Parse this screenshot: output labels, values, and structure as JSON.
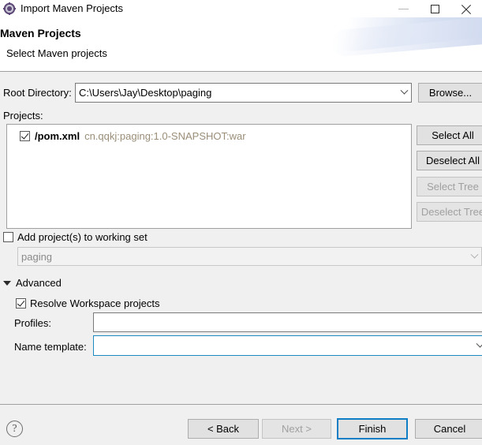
{
  "window": {
    "title": "Import Maven Projects",
    "icon": "maven-gear-icon",
    "controls": {
      "minimize": "minimize-icon",
      "maximize": "maximize-icon",
      "close": "close-icon"
    }
  },
  "header": {
    "title": "Maven Projects",
    "subtitle": "Select Maven projects"
  },
  "root_directory": {
    "label": "Root Directory:",
    "value": "C:\\Users\\Jay\\Desktop\\paging",
    "placeholder": "",
    "browse_label": "Browse..."
  },
  "projects": {
    "label": "Projects:",
    "items": [
      {
        "checked": true,
        "name": "/pom.xml",
        "coordinates": "cn.qqkj:paging:1.0-SNAPSHOT:war"
      }
    ],
    "buttons": {
      "select_all": "Select All",
      "deselect_all": "Deselect All",
      "select_tree": "Select Tree",
      "deselect_tree": "Deselect Tree"
    }
  },
  "working_set": {
    "checkbox_label": "Add project(s) to working set",
    "checked": false,
    "value": "paging",
    "enabled": false
  },
  "advanced": {
    "label": "Advanced",
    "expanded": true,
    "resolve_workspace": {
      "label": "Resolve Workspace projects",
      "checked": true
    },
    "profiles": {
      "label": "Profiles:",
      "value": "",
      "placeholder": ""
    },
    "name_template": {
      "label": "Name template:",
      "value": "",
      "placeholder": ""
    }
  },
  "footer": {
    "help": "help-icon",
    "back": "< Back",
    "next": "Next >",
    "finish": "Finish",
    "cancel": "Cancel"
  },
  "colors": {
    "accent": "#0f7ec4",
    "coordinates_text": "#9a8e78",
    "disabled_text": "#a0a0a0",
    "dialog_background": "#f0f0f0"
  }
}
